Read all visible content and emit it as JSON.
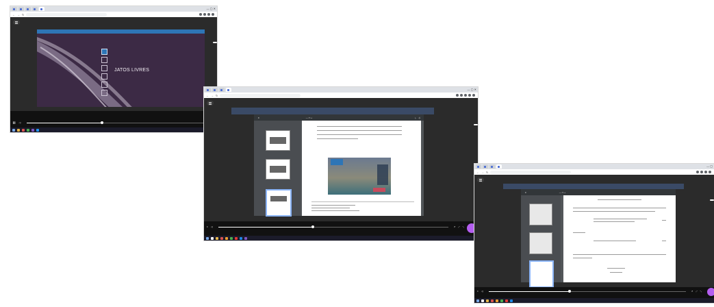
{
  "screens": [
    {
      "tabs": [
        "",
        "",
        "",
        "",
        ""
      ],
      "active_tab": 4,
      "url": "",
      "slide": {
        "title": "JATOS LIVRES",
        "bar_label": ""
      },
      "chat_chip": "",
      "player": {
        "time_current": "",
        "time_total": "",
        "progress": 0.41
      }
    },
    {
      "tabs": [
        "",
        "",
        "",
        ""
      ],
      "active_tab": 3,
      "url": "",
      "pdf": {
        "filename": "",
        "thumb_labels": [
          "",
          "",
          ""
        ]
      },
      "chat_chip": "",
      "player": {
        "time_current": "",
        "time_total": "",
        "progress": 0.41
      }
    },
    {
      "tabs": [
        "",
        "",
        "",
        ""
      ],
      "active_tab": 3,
      "url": "",
      "pdf": {
        "filename": "",
        "thumb_labels": [
          "",
          "",
          ""
        ]
      },
      "chat_chip": "",
      "player": {
        "time_current": "",
        "time_total": "",
        "progress": 0.41
      }
    }
  ],
  "colors": {
    "slide_bg": "#3c2a45",
    "slide_bar": "#2e75b6",
    "accent_purple": "#b45ef0",
    "chrome_tabbar": "#dee1e6"
  }
}
